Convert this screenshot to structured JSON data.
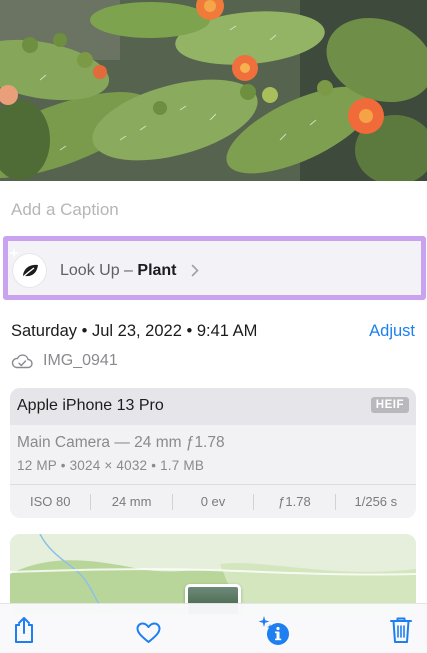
{
  "caption": {
    "placeholder": "Add a Caption"
  },
  "lookup": {
    "prefix": "Look Up – ",
    "subject": "Plant",
    "icon": "leaf-icon",
    "highlight_color": "#c9a2f0"
  },
  "metadata": {
    "datetime": "Saturday • Jul 23, 2022 • 9:41 AM",
    "adjust_label": "Adjust",
    "filename": "IMG_0941",
    "cloud_icon": "cloud-icon"
  },
  "device": {
    "name": "Apple iPhone 13 Pro",
    "format_badge": "HEIF",
    "lens": "Main Camera — 24 mm ƒ1.78",
    "specs": "12 MP • 3024 × 4032 • 1.7 MB",
    "exif": [
      "ISO 80",
      "24 mm",
      "0 ev",
      "ƒ1.78",
      "1/256 s"
    ]
  },
  "toolbar": {
    "items": [
      "share-icon",
      "heart-icon",
      "info-sparkle-icon",
      "trash-icon"
    ],
    "accent_color": "#1e7ff0"
  }
}
